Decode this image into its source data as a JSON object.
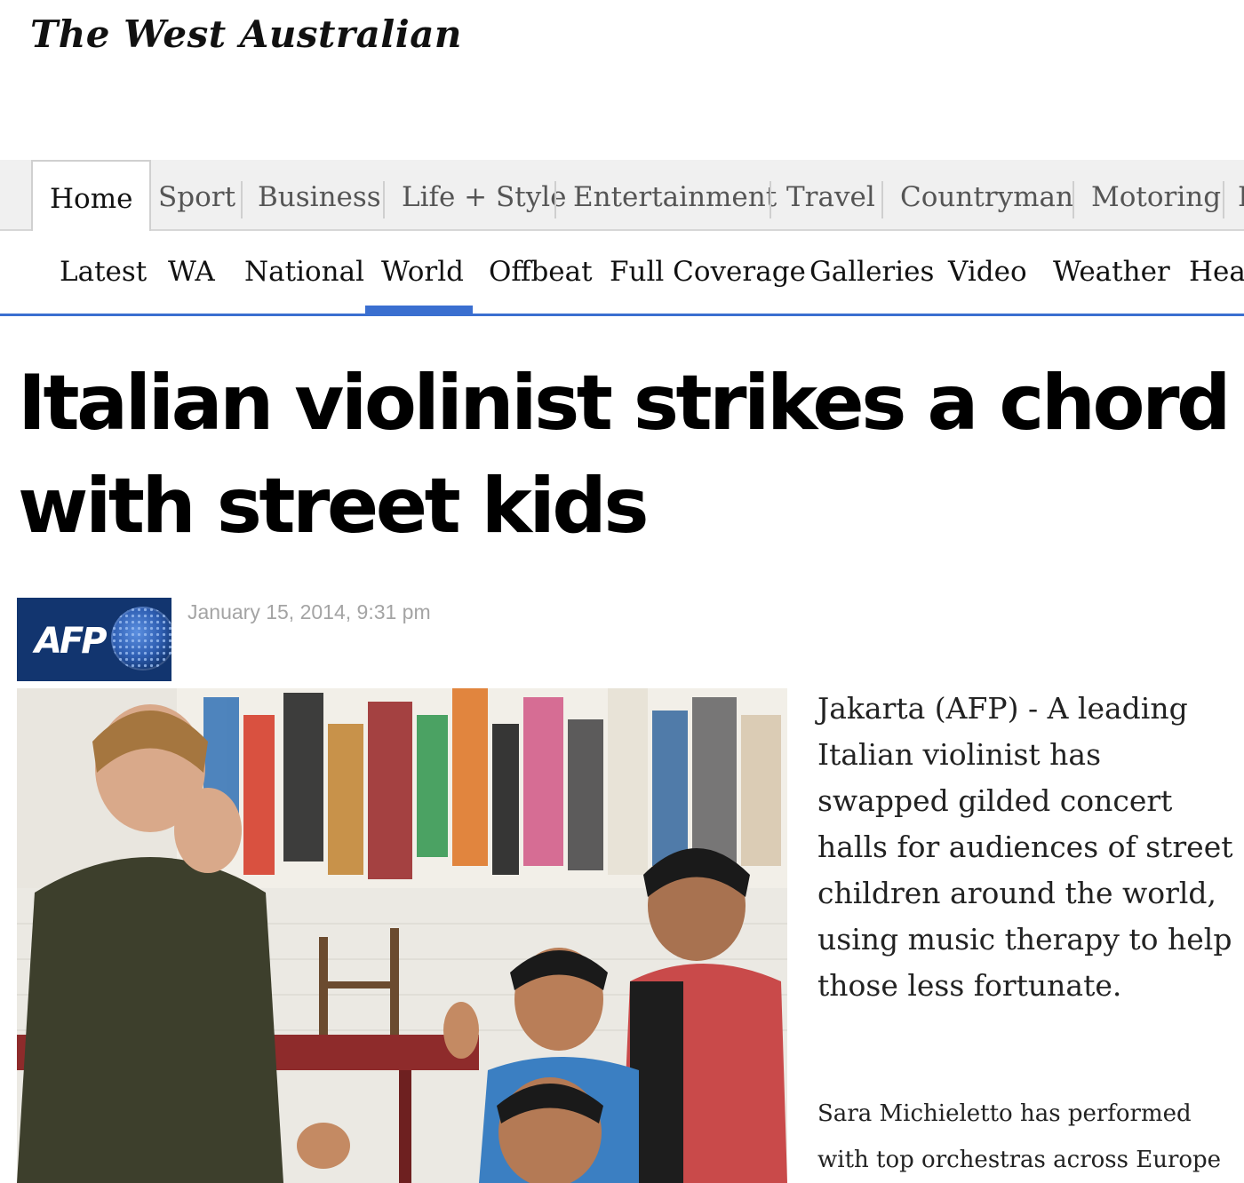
{
  "masthead": {
    "logo_text": "The West Australian"
  },
  "primary_nav": {
    "tabs": [
      "Home",
      "Sport",
      "Business",
      "Life + Style",
      "Entertainment",
      "Travel",
      "Countryman",
      "Motoring",
      "I"
    ],
    "active": "Home"
  },
  "secondary_nav": {
    "items": [
      "Latest",
      "WA",
      "National",
      "World",
      "Offbeat",
      "Full Coverage",
      "Galleries",
      "Video",
      "Weather",
      "Heal"
    ],
    "active": "World"
  },
  "article": {
    "headline": "Italian violinist strikes a chord with street kids",
    "source_logo": "AFP",
    "date": "January 15, 2014, 9:31 pm",
    "lede": "Jakarta (AFP) - A leading Italian violinist has swapped gilded concert halls for audiences of street children around the world, using music therapy to help those less fortunate.",
    "paragraph_1": "Sara Michieletto has performed with top orchestras across Europe"
  },
  "colors": {
    "nav_accent": "#3a6fd0",
    "afp_blue": "#12356f",
    "date_gray": "#a4a4a4"
  }
}
